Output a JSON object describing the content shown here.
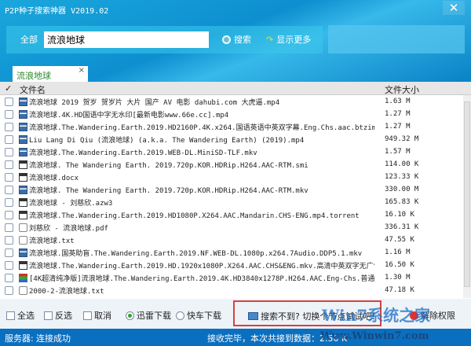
{
  "window": {
    "title": "P2P种子搜索神器 V2019.02",
    "close": "✕"
  },
  "search": {
    "scope": "全部",
    "query": "流浪地球",
    "search_label": "搜索",
    "more_label": "显示更多"
  },
  "tab": {
    "label": "流浪地球",
    "close": "×"
  },
  "table": {
    "check_header": "✓",
    "col_name": "文件名",
    "col_size": "文件大小",
    "rows": [
      {
        "icon": "video",
        "name": "流浪地球 2019 贺岁 贺岁片 大片 国产 AV 电影 dahubi.com 大虎逼.mp4",
        "size": "1.63 M"
      },
      {
        "icon": "video",
        "name": "流浪地球.4K.HD国语中字无水印[最新电影www.66e.cc].mp4",
        "size": "1.27 M"
      },
      {
        "icon": "video",
        "name": "流浪地球.The.Wandering.Earth.2019.HD2160P.4K.x264.国语英语中英双字幕.Eng.Chs.aac.btzimu.m",
        "size": "1.27 M"
      },
      {
        "icon": "video",
        "name": "Liu Lang Di Qiu (流浪地球) (a.k.a. The Wandering Earth) (2019).mp4",
        "size": "949.32 M"
      },
      {
        "icon": "video",
        "name": "流浪地球.The.Wandering.Earth.2019.WEB-DL.MiniSD-TLF.mkv",
        "size": "1.57 M"
      },
      {
        "icon": "doc",
        "name": " 流浪地球. The Wandering Earth. 2019.720p.KOR.HDRip.H264.AAC-RTM.smi",
        "size": "114.00 K"
      },
      {
        "icon": "doc",
        "name": "流浪地球.docx",
        "size": "123.33 K"
      },
      {
        "icon": "video",
        "name": " 流浪地球. The Wandering Earth. 2019.720p.KOR.HDRip.H264.AAC-RTM.mkv",
        "size": "330.00 M"
      },
      {
        "icon": "doc",
        "name": "流浪地球 - 刘慈欣.azw3",
        "size": "165.83 K"
      },
      {
        "icon": "doc",
        "name": "流浪地球.The.Wandering.Earth.2019.HD1080P.X264.AAC.Mandarin.CHS-ENG.mp4.torrent",
        "size": "16.10 K"
      },
      {
        "icon": "text",
        "name": "刘慈欣 - 流浪地球.pdf",
        "size": "336.31 K"
      },
      {
        "icon": "text",
        "name": "流浪地球.txt",
        "size": "47.55 K"
      },
      {
        "icon": "video",
        "name": "流浪地球.国英助盲.The.Wandering.Earth.2019.NF.WEB-DL.1080p.x264.7Audio.DDP5.1.mkv",
        "size": "1.16 M"
      },
      {
        "icon": "doc",
        "name": "流浪地球.The.Wandering.Earth.2019.HD.1920x1080P.X264.AAC.CHS&ENG.mkv.高清中英双字无广告.z",
        "size": "16.50 K"
      },
      {
        "icon": "archive",
        "name": "[4K超清纯净版]流浪地球.The.Wandering.Earth.2019.4K.HD3840x1278P.H264.AAC.Eng-Chs.普通话中",
        "size": "1.30 M"
      },
      {
        "icon": "text",
        "name": "2000-2-流浪地球.txt",
        "size": "47.18 K"
      }
    ]
  },
  "bottom": {
    "select_all": "全选",
    "invert": "反选",
    "cancel": "取消",
    "thunder": "迅雷下载",
    "flashget": "快车下载",
    "download_mode": "thunder",
    "hint": "搜索不到? 切换个节点试试吧!",
    "permission": "解除权限"
  },
  "status": {
    "server_label": "服务器:",
    "server_value": "连接成功",
    "receive": "接收完毕，本次共接到数据：2.50 K"
  },
  "watermark": {
    "text": "Win7系统之家",
    "url": "Www.Winwin7.com"
  },
  "colors": {
    "title_bar": "#0e8fd0",
    "status_bar": "#0b6fbf",
    "tab_text": "#2a8a2a",
    "hint_border": "#d84040"
  }
}
